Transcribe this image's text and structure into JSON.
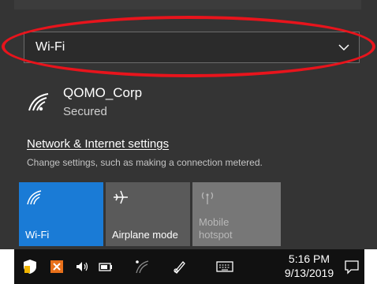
{
  "dropdown": {
    "selected": "Wi-Fi"
  },
  "network": {
    "ssid": "QOMO_Corp",
    "status": "Secured"
  },
  "settings": {
    "link": "Network & Internet settings",
    "description": "Change settings, such as making a connection metered."
  },
  "tiles": [
    {
      "label": "Wi-Fi",
      "icon": "wifi-icon",
      "active": true
    },
    {
      "label": "Airplane mode",
      "icon": "airplane-icon",
      "active": false
    },
    {
      "label": "Mobile\nhotspot",
      "icon": "hotspot-icon",
      "active": false
    }
  ],
  "taskbar": {
    "time": "5:16 PM",
    "date": "9/13/2019",
    "icons": [
      "defender-icon",
      "office-icon",
      "volume-icon",
      "battery-icon",
      "network-icon",
      "pen-icon",
      "keyboard-icon",
      "action-center-icon"
    ]
  },
  "colors": {
    "accent": "#1a7bd6",
    "highlight": "#e8141c",
    "panel": "#343434"
  }
}
